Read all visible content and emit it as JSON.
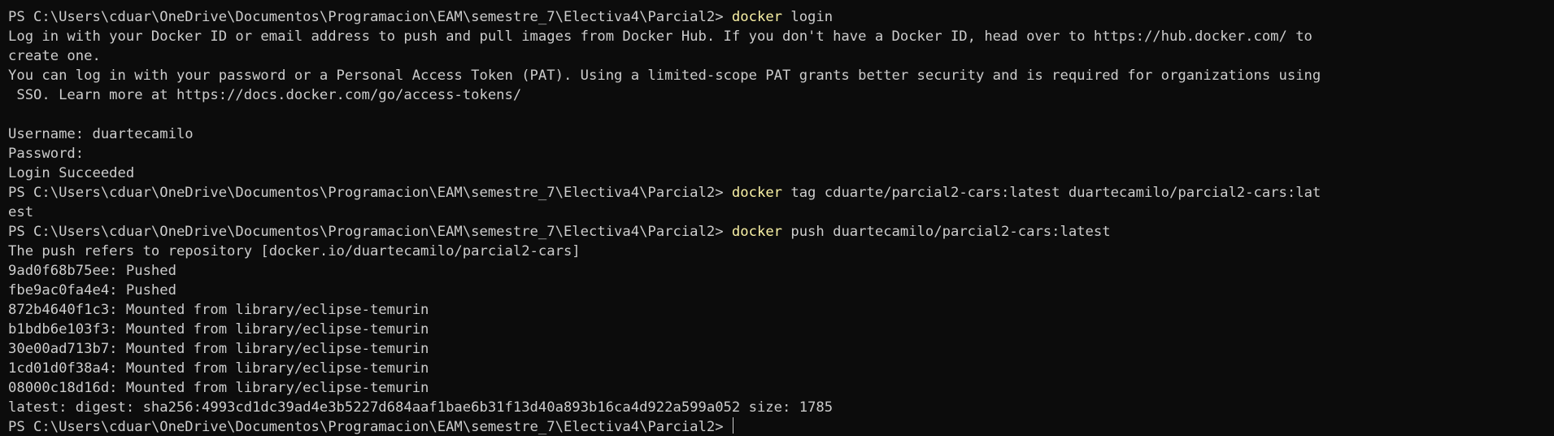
{
  "colors": {
    "background": "#0c0c0c",
    "foreground": "#cccccc",
    "command": "#f9f1a5"
  },
  "terminal": {
    "lines": [
      {
        "prompt": "PS C:\\Users\\cduar\\OneDrive\\Documentos\\Programacion\\EAM\\semestre_7\\Electiva4\\Parcial2> ",
        "cmd": "docker",
        "args": " login"
      },
      {
        "text": "Log in with your Docker ID or email address to push and pull images from Docker Hub. If you don't have a Docker ID, head over to https://hub.docker.com/ to"
      },
      {
        "text": "create one."
      },
      {
        "text": "You can log in with your password or a Personal Access Token (PAT). Using a limited-scope PAT grants better security and is required for organizations using"
      },
      {
        "text": " SSO. Learn more at https://docs.docker.com/go/access-tokens/"
      },
      {
        "text": ""
      },
      {
        "text": "Username: duartecamilo"
      },
      {
        "text": "Password:"
      },
      {
        "text": "Login Succeeded"
      },
      {
        "prompt": "PS C:\\Users\\cduar\\OneDrive\\Documentos\\Programacion\\EAM\\semestre_7\\Electiva4\\Parcial2> ",
        "cmd": "docker",
        "args": " tag cduarte/parcial2-cars:latest duartecamilo/parcial2-cars:lat"
      },
      {
        "text": "est"
      },
      {
        "prompt": "PS C:\\Users\\cduar\\OneDrive\\Documentos\\Programacion\\EAM\\semestre_7\\Electiva4\\Parcial2> ",
        "cmd": "docker",
        "args": " push duartecamilo/parcial2-cars:latest"
      },
      {
        "text": "The push refers to repository [docker.io/duartecamilo/parcial2-cars]"
      },
      {
        "text": "9ad0f68b75ee: Pushed"
      },
      {
        "text": "fbe9ac0fa4e4: Pushed"
      },
      {
        "text": "872b4640f1c3: Mounted from library/eclipse-temurin"
      },
      {
        "text": "b1bdb6e103f3: Mounted from library/eclipse-temurin"
      },
      {
        "text": "30e00ad713b7: Mounted from library/eclipse-temurin"
      },
      {
        "text": "1cd01d0f38a4: Mounted from library/eclipse-temurin"
      },
      {
        "text": "08000c18d16d: Mounted from library/eclipse-temurin"
      },
      {
        "text": "latest: digest: sha256:4993cd1dc39ad4e3b5227d684aaf1bae6b31f13d40a893b16ca4d922a599a052 size: 1785"
      },
      {
        "prompt": "PS C:\\Users\\cduar\\OneDrive\\Documentos\\Programacion\\EAM\\semestre_7\\Electiva4\\Parcial2> ",
        "cursor": true
      }
    ]
  }
}
